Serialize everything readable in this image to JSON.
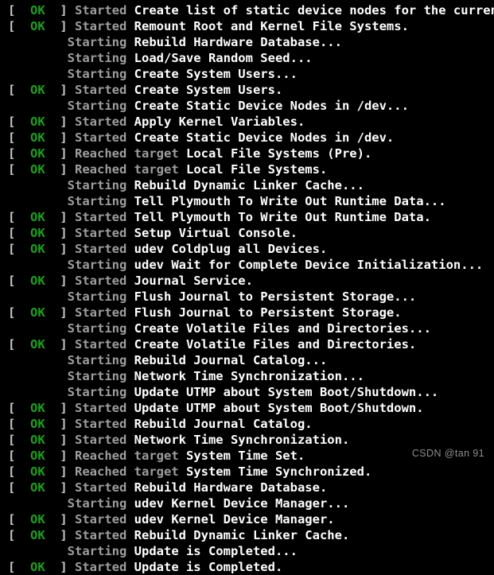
{
  "console": {
    "background_color": "#000000",
    "bracket_color": "#c8c8c8",
    "ok_color": "#19a319",
    "verb_color": "#9e9e9e",
    "unit_color": "#ffffff",
    "bracket_open": "[",
    "bracket_close": "]",
    "status_ok": "OK",
    "indent": "        ",
    "lines": [
      {
        "type": "status",
        "status": "OK",
        "verb": "Started ",
        "unit": "Create list of static device nodes for the current kernel."
      },
      {
        "type": "status",
        "status": "OK",
        "verb": "Started ",
        "unit": "Remount Root and Kernel File Systems."
      },
      {
        "type": "plain",
        "verb": "Starting ",
        "unit": "Rebuild Hardware Database..."
      },
      {
        "type": "plain",
        "verb": "Starting ",
        "unit": "Load/Save Random Seed..."
      },
      {
        "type": "plain",
        "verb": "Starting ",
        "unit": "Create System Users..."
      },
      {
        "type": "status",
        "status": "OK",
        "verb": "Started ",
        "unit": "Create System Users."
      },
      {
        "type": "plain",
        "verb": "Starting ",
        "unit": "Create Static Device Nodes in /dev..."
      },
      {
        "type": "status",
        "status": "OK",
        "verb": "Started ",
        "unit": "Apply Kernel Variables."
      },
      {
        "type": "status",
        "status": "OK",
        "verb": "Started ",
        "unit": "Create Static Device Nodes in /dev."
      },
      {
        "type": "status",
        "status": "OK",
        "verb": "Reached target ",
        "unit": "Local File Systems (Pre)."
      },
      {
        "type": "status",
        "status": "OK",
        "verb": "Reached target ",
        "unit": "Local File Systems."
      },
      {
        "type": "plain",
        "verb": "Starting ",
        "unit": "Rebuild Dynamic Linker Cache..."
      },
      {
        "type": "plain",
        "verb": "Starting ",
        "unit": "Tell Plymouth To Write Out Runtime Data..."
      },
      {
        "type": "status",
        "status": "OK",
        "verb": "Started ",
        "unit": "Tell Plymouth To Write Out Runtime Data."
      },
      {
        "type": "status",
        "status": "OK",
        "verb": "Started ",
        "unit": "Setup Virtual Console."
      },
      {
        "type": "status",
        "status": "OK",
        "verb": "Started ",
        "unit": "udev Coldplug all Devices."
      },
      {
        "type": "plain",
        "verb": "Starting ",
        "unit": "udev Wait for Complete Device Initialization..."
      },
      {
        "type": "status",
        "status": "OK",
        "verb": "Started ",
        "unit": "Journal Service."
      },
      {
        "type": "plain",
        "verb": "Starting ",
        "unit": "Flush Journal to Persistent Storage..."
      },
      {
        "type": "status",
        "status": "OK",
        "verb": "Started ",
        "unit": "Flush Journal to Persistent Storage."
      },
      {
        "type": "plain",
        "verb": "Starting ",
        "unit": "Create Volatile Files and Directories..."
      },
      {
        "type": "status",
        "status": "OK",
        "verb": "Started ",
        "unit": "Create Volatile Files and Directories."
      },
      {
        "type": "plain",
        "verb": "Starting ",
        "unit": "Rebuild Journal Catalog..."
      },
      {
        "type": "plain",
        "verb": "Starting ",
        "unit": "Network Time Synchronization..."
      },
      {
        "type": "plain",
        "verb": "Starting ",
        "unit": "Update UTMP about System Boot/Shutdown..."
      },
      {
        "type": "status",
        "status": "OK",
        "verb": "Started ",
        "unit": "Update UTMP about System Boot/Shutdown."
      },
      {
        "type": "status",
        "status": "OK",
        "verb": "Started ",
        "unit": "Rebuild Journal Catalog."
      },
      {
        "type": "status",
        "status": "OK",
        "verb": "Started ",
        "unit": "Network Time Synchronization."
      },
      {
        "type": "status",
        "status": "OK",
        "verb": "Reached target ",
        "unit": "System Time Set."
      },
      {
        "type": "status",
        "status": "OK",
        "verb": "Reached target ",
        "unit": "System Time Synchronized."
      },
      {
        "type": "status",
        "status": "OK",
        "verb": "Started ",
        "unit": "Rebuild Hardware Database."
      },
      {
        "type": "plain",
        "verb": "Starting ",
        "unit": "udev Kernel Device Manager..."
      },
      {
        "type": "status",
        "status": "OK",
        "verb": "Started ",
        "unit": "udev Kernel Device Manager."
      },
      {
        "type": "status",
        "status": "OK",
        "verb": "Started ",
        "unit": "Rebuild Dynamic Linker Cache."
      },
      {
        "type": "plain",
        "verb": "Starting ",
        "unit": "Update is Completed..."
      },
      {
        "type": "status",
        "status": "OK",
        "verb": "Started ",
        "unit": "Update is Completed."
      }
    ]
  },
  "watermark": {
    "text": "CSDN @tan 91",
    "color": "#8d8d8d"
  }
}
